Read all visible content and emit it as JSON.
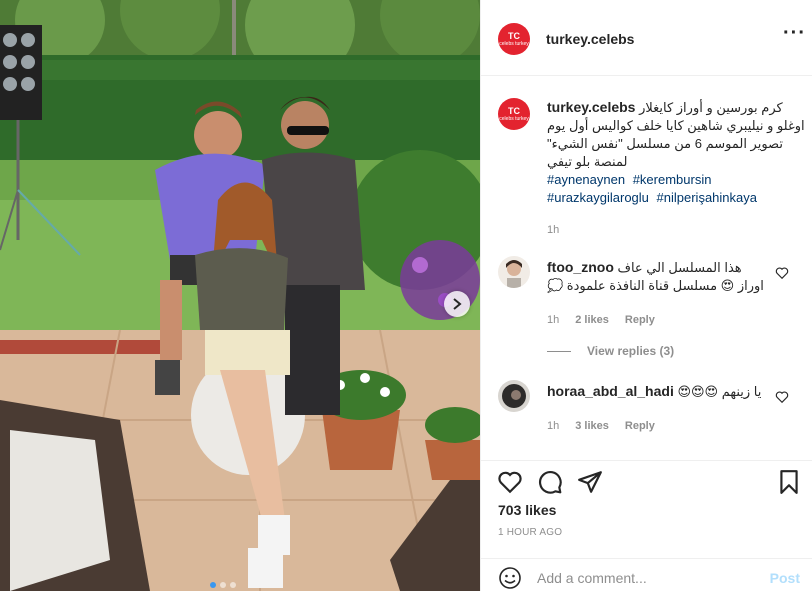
{
  "post": {
    "username": "turkey.celebs",
    "brand_mark": "TC",
    "brand_sub": "celebs turkey",
    "more_label": "···"
  },
  "caption": {
    "username": "turkey.celebs",
    "text": "كرم بورسين و أوراز كايغلار اوغلو و نيليبري شاهين كايا خلف كواليس أول يوم تصوير الموسم 6 من مسلسل \"نفس الشيء\" لمنصة بلو تيفي",
    "tags": [
      "#aynenaynen",
      "#kerembursin",
      "#urazkaygilaroglu",
      "#nilperişahinkaya"
    ],
    "time": "1h"
  },
  "comments": [
    {
      "username": "ftoo_znoo",
      "text": "هذا المسلسل الي عاف اوراز 😍 مسلسل قناة النافذة علمودة 💭",
      "time": "1h",
      "likes": "2 likes",
      "reply": "Reply",
      "view_replies": "View replies (3)"
    },
    {
      "username": "horaa_abd_al_hadi",
      "text": "يا زينهم 😍😍😍",
      "time": "1h",
      "likes": "3 likes",
      "reply": "Reply"
    }
  ],
  "likes_count": "703 likes",
  "timestamp": "1 HOUR AGO",
  "add_comment": {
    "placeholder": "Add a comment...",
    "post_label": "Post"
  },
  "colors": {
    "brand_red": "#e3232f",
    "link_blue": "#00376b",
    "post_disabled": "#b2dffc",
    "carousel_active": "#3897f0"
  },
  "carousel": {
    "total": 3,
    "active": 1
  }
}
